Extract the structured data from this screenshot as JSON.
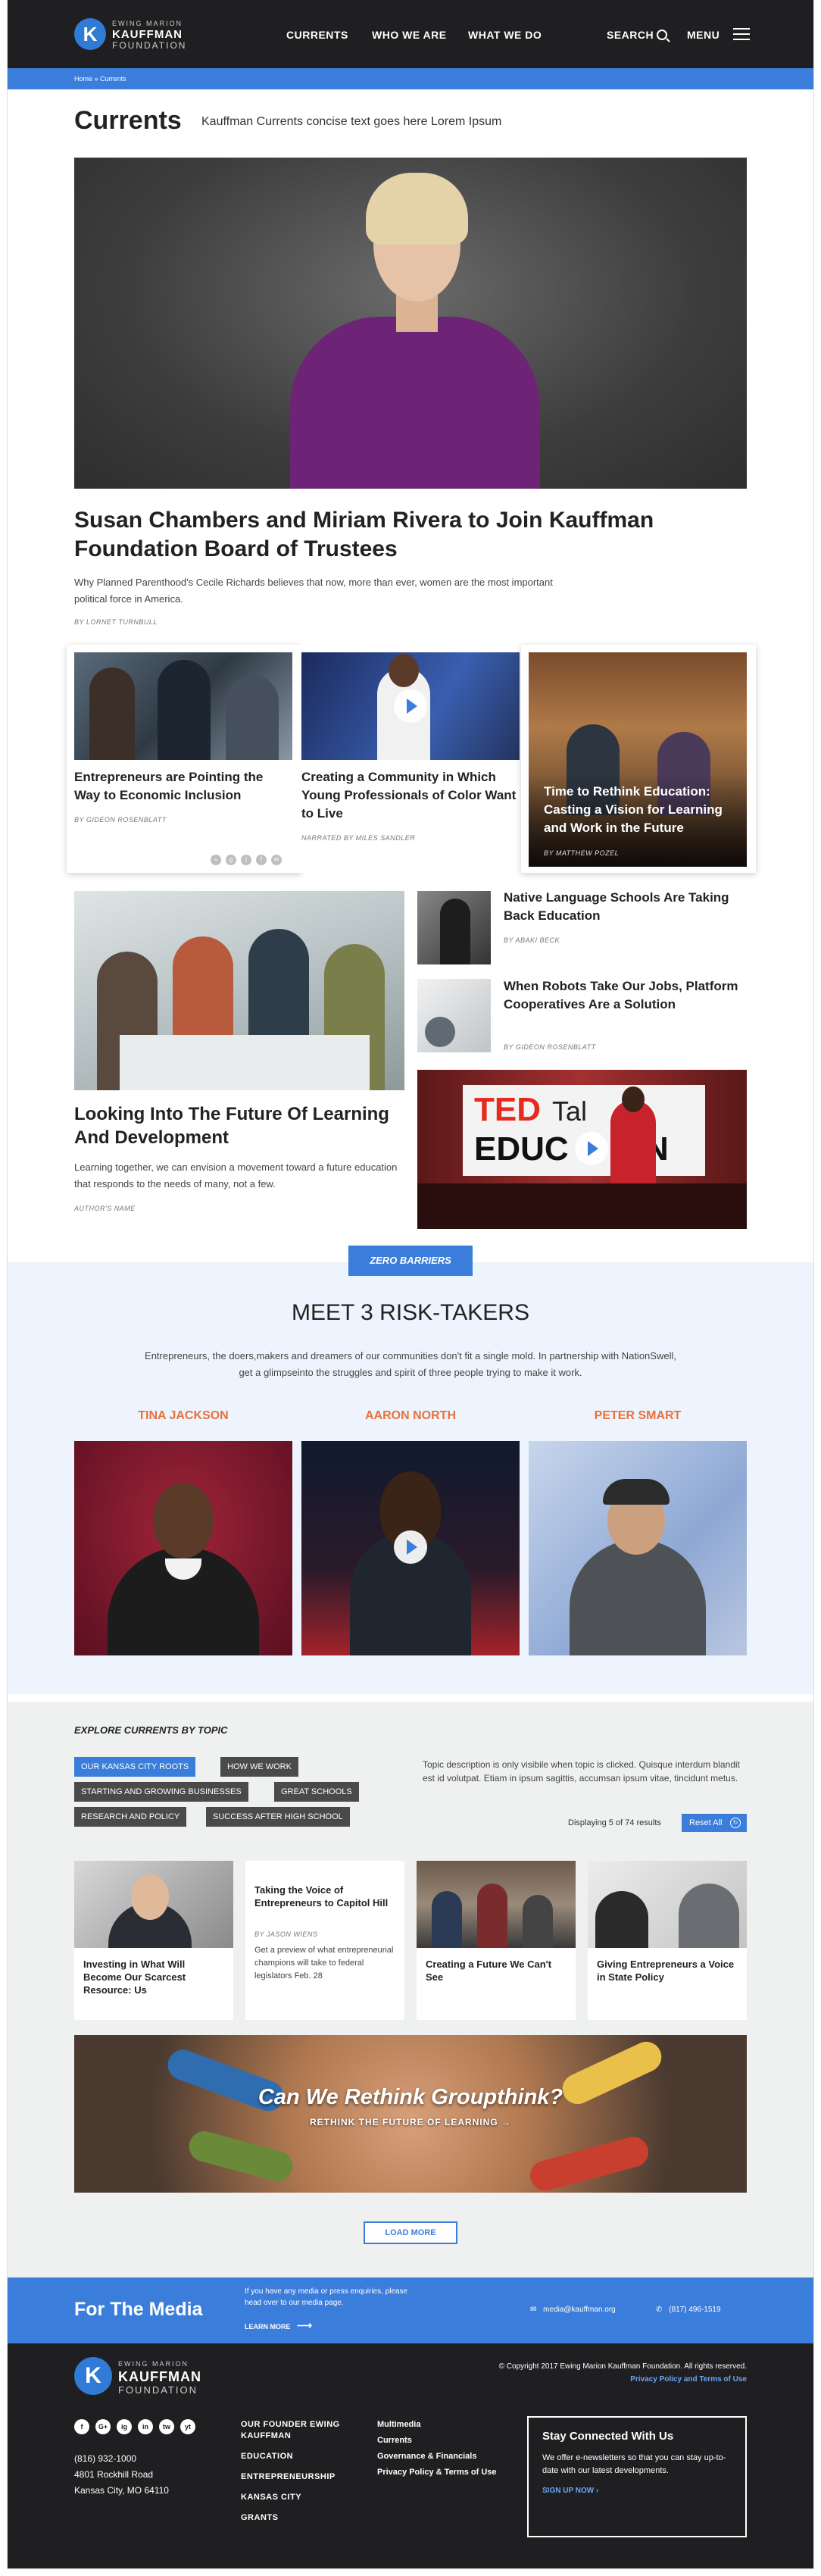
{
  "header": {
    "logo": {
      "mark": "K",
      "line1": "EWING MARION",
      "line2": "KAUFFMAN",
      "line3": "FOUNDATION"
    },
    "nav": [
      "CURRENTS",
      "WHO WE ARE",
      "WHAT WE DO"
    ],
    "search_label": "SEARCH",
    "menu_label": "MENU"
  },
  "breadcrumbs": {
    "home": "Home",
    "sep": "»",
    "current": "Currents"
  },
  "page": {
    "title": "Currents",
    "subtitle": "Kauffman Currents concise text goes here Lorem Ipsum"
  },
  "hero": {
    "title": "Susan Chambers and Miriam Rivera to Join Kauffman Foundation Board of Trustees",
    "desc": "Why Planned Parenthood's Cecile Richards believes that now, more than ever, women are the most important political force in America.",
    "byline": "BY LORNET TURNBULL"
  },
  "cards": [
    {
      "title": "Entrepreneurs are Pointing the Way to Economic Inclusion",
      "byline": "BY GIDEON ROSENBLATT"
    },
    {
      "title": "Creating a Community in Which Young Professionals of Color Want to Live",
      "byline": "NARRATED BY MILES SANDLER"
    },
    {
      "title": "Time to Rethink Education: Casting a Vision for Learning and Work in the Future",
      "byline": "BY MATTHEW POZEL"
    }
  ],
  "share_icons": [
    "link-icon",
    "google-plus-icon",
    "twitter-icon",
    "facebook-icon",
    "email-icon"
  ],
  "feature": {
    "title": "Looking Into The Future Of Learning And Development",
    "desc": "Learning together, we can envision a movement toward a future education that responds to the needs of many, not a few.",
    "byline": "AUTHOR'S NAME"
  },
  "side_items": [
    {
      "title": "Native Language Schools Are Taking Back Education",
      "byline": "BY ABAKI BECK"
    },
    {
      "title": "When Robots Take Our Jobs, Platform Cooperatives Are a Solution",
      "byline": "BY GIDEON ROSENBLATT"
    }
  ],
  "ted_sign": {
    "line1": "TED",
    "line1b": "Tal",
    "line2": "EDUC",
    "line2b": "N"
  },
  "zero_barriers": "ZERO BARRIERS",
  "risk": {
    "title": "MEET 3 RISK-TAKERS",
    "desc": "Entrepreneurs, the doers,makers and dreamers of our communities don't fit a single mold. In partnership with NationSwell, get a glimpseinto the struggles and spirit of three people trying to make it work.",
    "names": [
      "TINA JACKSON",
      "AARON NORTH",
      "PETER SMART"
    ]
  },
  "explore": {
    "title": "EXPLORE CURRENTS BY TOPIC",
    "tags_row1": [
      "OUR KANSAS CITY ROOTS",
      "HOW WE WORK"
    ],
    "tags_row2": [
      "STARTING AND GROWING BUSINESSES",
      "GREAT SCHOOLS"
    ],
    "tags_row3": [
      "RESEARCH AND POLICY",
      "SUCCESS AFTER HIGH SCHOOL"
    ],
    "topic_desc": "Topic description is only visibile when topic is clicked. Quisque interdum blandit est id volutpat. Etiam in ipsum sagittis, accumsan ipsum vitae, tincidunt metus.",
    "results": "Displaying 5 of 74 results",
    "reset": "Reset All"
  },
  "topic_cards": [
    {
      "title": "Investing in What Will Become Our Scarcest Resource: Us"
    },
    {
      "title": "Taking the Voice of Entrepreneurs to Capitol Hill",
      "byline": "BY JASON WIENS",
      "desc": "Get a preview of what entrepreneurial champions will take to federal legislators Feb. 28"
    },
    {
      "title": "Creating a Future We Can't See"
    },
    {
      "title": "Giving Entrepreneurs a Voice in State Policy"
    }
  ],
  "banner": {
    "title": "Can We Rethink Groupthink?",
    "sub": "RETHINK THE FUTURE OF LEARNING →"
  },
  "load_more": "LOAD MORE",
  "media": {
    "title": "For The Media",
    "desc": "If you have any media or press enquiries, please head over to our media page.",
    "link": "LEARN MORE",
    "email": "media@kauffman.org",
    "phone": "(817) 496-1519"
  },
  "footer": {
    "copyright": "© Copyright 2017 Ewing Marion Kauffman Foundation. All rights reserved.",
    "policy": "Privacy Policy and Terms of Use",
    "social": [
      "f",
      "G+",
      "ig",
      "in",
      "tw",
      "yt"
    ],
    "address": [
      "(816) 932-1000",
      "4801 Rockhill Road",
      "Kansas City, MO 64110"
    ],
    "links1": [
      "OUR FOUNDER EWING KAUFFMAN",
      "EDUCATION",
      "ENTREPRENEURSHIP",
      "KANSAS CITY",
      "GRANTS"
    ],
    "links2": [
      "Multimedia",
      "Currents",
      "Governance & Financials",
      "Privacy Policy & Terms of Use"
    ],
    "stay": {
      "title": "Stay Connected With Us",
      "desc": "We offer e-newsletters so that you can stay up-to-date with our latest developments.",
      "link": "SIGN UP NOW ›"
    }
  }
}
